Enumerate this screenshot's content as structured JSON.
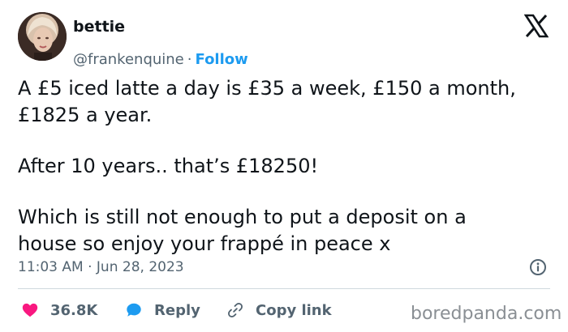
{
  "author": {
    "name": "bettie",
    "handle": "@frankenquine",
    "separator": "·",
    "follow_label": "Follow",
    "avatar_icon": "user-avatar-icon"
  },
  "platform_icon": "x-logo-icon",
  "tweet": {
    "paragraphs": [
      "A £5 iced latte a day is £35 a week, £150 a month,\n£1825 a year.",
      "After 10 years.. that’s £18250!",
      "Which is still not enough to put a deposit on a\nhouse so enjoy your frappé in peace x"
    ]
  },
  "meta": {
    "time": "11:03 AM",
    "separator": "·",
    "date": "Jun 28, 2023"
  },
  "actions": {
    "like_count": "36.8K",
    "reply_label": "Reply",
    "copy_label": "Copy link"
  },
  "watermark": "boredpanda.com",
  "colors": {
    "like": "#f91880",
    "reply": "#1d9bf0",
    "link": "#1d9bf0",
    "muted": "#536471",
    "text": "#0f1419"
  }
}
